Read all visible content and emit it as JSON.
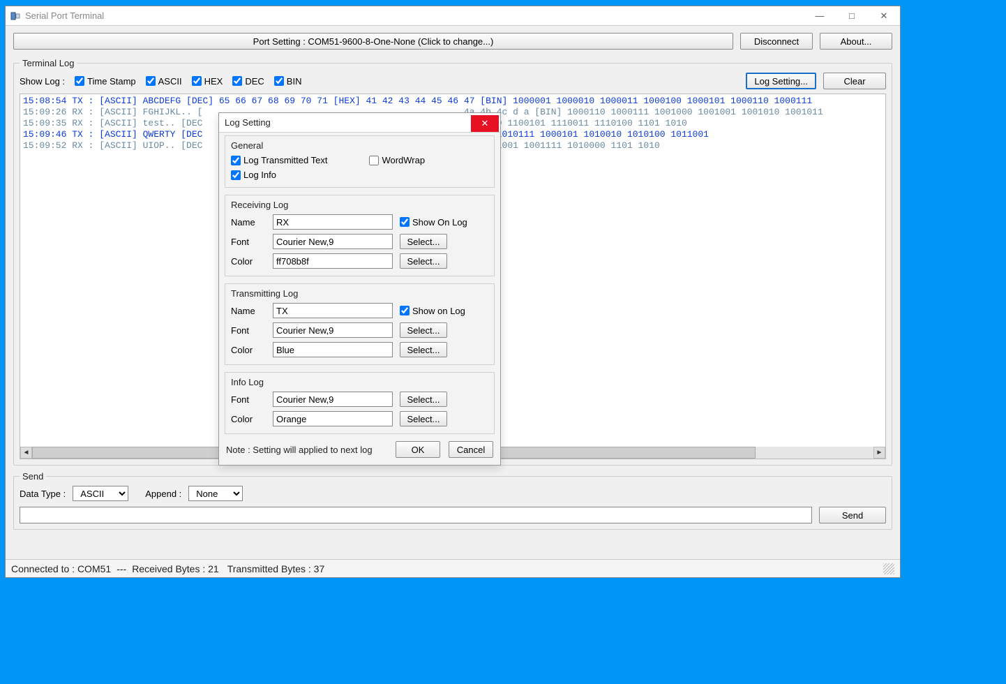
{
  "window": {
    "title": "Serial Port Terminal"
  },
  "toolbar": {
    "port_setting": "Port Setting : COM51-9600-8-One-None (Click to change...)",
    "disconnect": "Disconnect",
    "about": "About..."
  },
  "terminal": {
    "legend": "Terminal Log",
    "showlog_label": "Show Log :",
    "opts": {
      "timestamp": "Time Stamp",
      "ascii": "ASCII",
      "hex": "HEX",
      "dec": "DEC",
      "bin": "BIN"
    },
    "log_setting_btn": "Log Setting...",
    "clear_btn": "Clear",
    "lines": [
      {
        "cls": "tx",
        "text": "15:08:54 TX : [ASCII] ABCDEFG [DEC] 65 66 67 68 69 70 71 [HEX] 41 42 43 44 45 46 47 [BIN] 1000001 1000010 1000011 1000100 1000101 1000110 1000111"
      },
      {
        "cls": "rx",
        "text": "15:09:26 RX : [ASCII] FGHIJKL.. [                                                4a 4b 4c d a [BIN] 1000110 1000111 1001000 1001001 1001010 1001011"
      },
      {
        "cls": "rx",
        "text": "15:09:35 RX : [ASCII] test.. [DEC                                             N] 1110100 1100101 1110011 1110100 1101 1010"
      },
      {
        "cls": "tx",
        "text": "15:09:46 TX : [ASCII] QWERTY [DEC                                              1010001 1010111 1000101 1010010 1010100 1011001"
      },
      {
        "cls": "rx",
        "text": "15:09:52 RX : [ASCII] UIOP.. [DEC                                            010101 1001001 1001111 1010000 1101 1010"
      }
    ]
  },
  "send": {
    "legend": "Send",
    "datatype_label": "Data Type :",
    "datatype_value": "ASCII",
    "append_label": "Append :",
    "append_value": "None",
    "send_btn": "Send"
  },
  "status": {
    "connected": "Connected to : COM51",
    "sep": "---",
    "received": "Received Bytes :  21",
    "transmitted": "Transmitted Bytes :  37"
  },
  "modal": {
    "title": "Log Setting",
    "general": {
      "legend": "General",
      "log_tx": "Log Transmitted Text",
      "wordwrap": "WordWrap",
      "log_info": "Log Info"
    },
    "rx": {
      "legend": "Receiving Log",
      "name_label": "Name",
      "name_value": "RX",
      "show_on_log": "Show On Log",
      "font_label": "Font",
      "font_value": "Courier New,9",
      "color_label": "Color",
      "color_value": "ff708b8f",
      "select": "Select..."
    },
    "tx": {
      "legend": "Transmitting Log",
      "name_label": "Name",
      "name_value": "TX",
      "show_on_log": "Show on Log",
      "font_label": "Font",
      "font_value": "Courier New,9",
      "color_label": "Color",
      "color_value": "Blue",
      "select": "Select..."
    },
    "info": {
      "legend": "Info Log",
      "font_label": "Font",
      "font_value": "Courier New,9",
      "color_label": "Color",
      "color_value": "Orange",
      "select": "Select..."
    },
    "note": "Note : Setting will applied to next log",
    "ok": "OK",
    "cancel": "Cancel"
  }
}
